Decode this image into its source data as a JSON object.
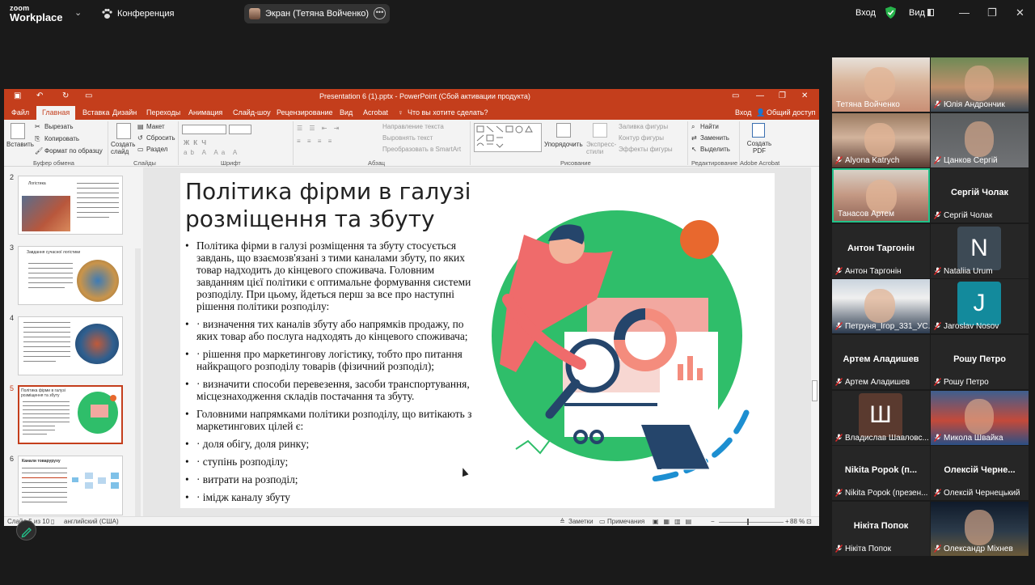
{
  "zoom": {
    "logo_line1": "zoom",
    "logo_line2": "Workplace",
    "conference_label": "Конференция",
    "screen_share_label": "Экран (Тетяна Войченко)",
    "sign_in_label": "Вход",
    "view_label": "Вид"
  },
  "ppt": {
    "window_title": "Presentation 6 (1).pptx - PowerPoint (Сбой активации продукта)",
    "tabs": [
      "Файл",
      "Главная",
      "Вставка",
      "Дизайн",
      "Переходы",
      "Анимация",
      "Слайд-шоу",
      "Рецензирование",
      "Вид",
      "Acrobat"
    ],
    "tell_me": "Что вы хотите сделать?",
    "sign_in": "Вход",
    "share": "Общий доступ",
    "ribbon": {
      "paste": "Вставить",
      "cut": "Вырезать",
      "copy": "Копировать",
      "format_painter": "Формат по образцу",
      "clipboard_group": "Буфер обмена",
      "new_slide": "Создать слайд",
      "layout": "Макет",
      "reset": "Сбросить",
      "section": "Раздел",
      "slides_group": "Слайды",
      "font_group": "Шрифт",
      "text_direction": "Направление текста",
      "align_text": "Выровнять текст",
      "smartart": "Преобразовать в SmartArt",
      "paragraph_group": "Абзац",
      "arrange": "Упорядочить",
      "quick_styles": "Экспресс-стили",
      "shape_fill": "Заливка фигуры",
      "shape_outline": "Контур фигуры",
      "shape_effects": "Эффекты фигуры",
      "drawing_group": "Рисование",
      "find": "Найти",
      "replace": "Заменить",
      "select": "Выделить",
      "editing_group": "Редактирование",
      "create_pdf": "Создать PDF",
      "acrobat_group": "Adobe Acrobat"
    },
    "thumbnails": [
      {
        "num": "2",
        "title": "Логістика"
      },
      {
        "num": "3",
        "title": "Завдання сучасної логістики"
      },
      {
        "num": "4",
        "title": ""
      },
      {
        "num": "5",
        "title": "Політика фірми в галузі розміщення та збуту"
      },
      {
        "num": "6",
        "title": "Канали товаруруху"
      }
    ],
    "slide": {
      "title": "Політика фірми в галузі розміщення та збуту",
      "bullets": [
        "Політика фірми в галузі розміщення та збуту стосується завдань, що взаємозв'язані з тими каналами збуту, по яких товар надходить до кінцевого споживача. Головним завданням цієї політики є оптимальне формування системи розподілу. При цьому, йдеться перш за все про наступні рішення політики розподілу:",
        "· визначення тих каналів збуту або напрямків продажу, по яких товар або послуга надходять до кінцевого споживача;",
        "· рішення про маркетингову логістику, тобто про питання найкращого розподілу товарів (фізичний розподіл);",
        "· визначити способи перевезення, засоби транспортування, місцезнаходження складів постачання та збуту.",
        "Головними напрямками політики розподілу, що витікають з маркетингових цілей є:",
        "· доля обігу, доля ринку;",
        "· ступінь розподілу;",
        "· витрати на розподіл;",
        "· імідж каналу збуту"
      ]
    },
    "status": {
      "slide_counter": "Слайд 5 из 10",
      "language": "английский (США)",
      "notes": "Заметки",
      "comments": "Примечания",
      "zoom": "88 %"
    }
  },
  "participants": [
    {
      "name": "Тетяна Войченко",
      "big": "",
      "avatar": "",
      "avatar_color": "",
      "muted": false,
      "photo": true,
      "active": false
    },
    {
      "name": "Юлія Андрончик",
      "big": "",
      "avatar": "",
      "avatar_color": "",
      "muted": true,
      "photo": true,
      "active": false
    },
    {
      "name": "Alyona Katrych",
      "big": "",
      "avatar": "",
      "avatar_color": "",
      "muted": true,
      "photo": true,
      "active": false
    },
    {
      "name": "Цанков Сергій",
      "big": "",
      "avatar": "",
      "avatar_color": "",
      "muted": true,
      "photo": true,
      "active": false
    },
    {
      "name": "Танасов Артем",
      "big": "",
      "avatar": "",
      "avatar_color": "",
      "muted": false,
      "photo": true,
      "active": true
    },
    {
      "name": "Сергій Чолак",
      "big": "Сергій Чолак",
      "avatar": "",
      "avatar_color": "",
      "muted": true,
      "photo": false,
      "active": false
    },
    {
      "name": "Антон Таргонін",
      "big": "Антон Таргонін",
      "avatar": "",
      "avatar_color": "",
      "muted": true,
      "photo": false,
      "active": false
    },
    {
      "name": "Nataliia Urum",
      "big": "",
      "avatar": "N",
      "avatar_color": "#3d4a55",
      "muted": true,
      "photo": false,
      "active": false
    },
    {
      "name": "Петруня_Ігор_331_УС...",
      "big": "",
      "avatar": "",
      "avatar_color": "",
      "muted": true,
      "photo": true,
      "active": false
    },
    {
      "name": "Jaroslav Nosov",
      "big": "",
      "avatar": "J",
      "avatar_color": "#138a9c",
      "muted": true,
      "photo": false,
      "active": false
    },
    {
      "name": "Артем Аладишев",
      "big": "Артем Аладишев",
      "avatar": "",
      "avatar_color": "",
      "muted": true,
      "photo": false,
      "active": false
    },
    {
      "name": "Рошу Петро",
      "big": "Рошу Петро",
      "avatar": "",
      "avatar_color": "",
      "muted": true,
      "photo": false,
      "active": false
    },
    {
      "name": "Владислав Шавловс...",
      "big": "",
      "avatar": "Ш",
      "avatar_color": "#5a3a2f",
      "muted": true,
      "photo": false,
      "active": false
    },
    {
      "name": "Микола Швайка",
      "big": "",
      "avatar": "",
      "avatar_color": "",
      "muted": true,
      "photo": true,
      "active": false
    },
    {
      "name": "Nikita Popok (презен...",
      "big": "Nikita Popok (п...",
      "avatar": "",
      "avatar_color": "",
      "muted": true,
      "photo": false,
      "active": false
    },
    {
      "name": "Олексій Чернецький",
      "big": "Олексій Черне...",
      "avatar": "",
      "avatar_color": "",
      "muted": true,
      "photo": false,
      "active": false
    },
    {
      "name": "Нікіта Попок",
      "big": "Нікіта Попок",
      "avatar": "",
      "avatar_color": "",
      "muted": true,
      "photo": false,
      "active": false
    },
    {
      "name": "Олександр Міхнев",
      "big": "",
      "avatar": "",
      "avatar_color": "",
      "muted": true,
      "photo": true,
      "active": false
    }
  ],
  "colors": {
    "ppt_accent": "#c43e1c",
    "zoom_bg": "#1a1a1a",
    "active_speaker": "#22c28a",
    "mic_muted": "#e02828"
  }
}
